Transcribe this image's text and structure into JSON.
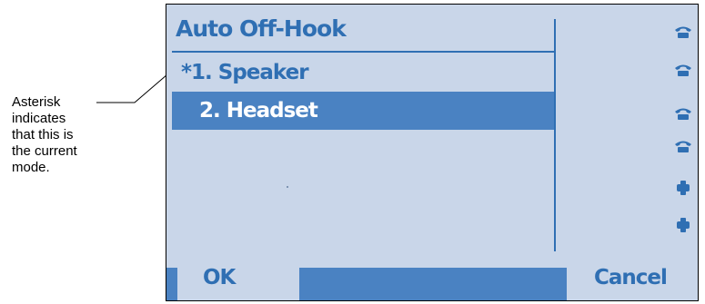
{
  "callout": {
    "text": "Asterisk\nindicates\nthat this is\nthe current\nmode."
  },
  "screen": {
    "title": "Auto Off-Hook",
    "menu_items": [
      {
        "label": "*1. Speaker",
        "selected": false
      },
      {
        "label": "2. Headset",
        "selected": true
      }
    ],
    "softkeys": {
      "ok": "OK",
      "cancel": "Cancel"
    },
    "line_icons": [
      "phone-icon",
      "phone-icon",
      "phone-icon",
      "phone-icon",
      "dot-icon",
      "dot-icon"
    ]
  },
  "colors": {
    "screen_bg": "#c9d6e9",
    "accent": "#2f6fb3",
    "highlight": "#4a82c2",
    "highlight_text": "#ffffff"
  }
}
